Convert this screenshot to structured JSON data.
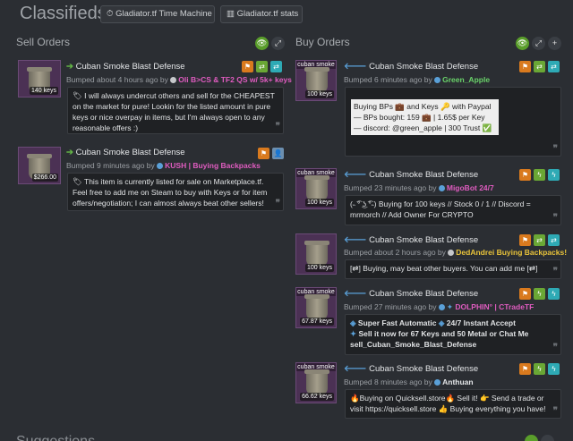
{
  "header": {
    "title": "Classifieds",
    "btn_time_machine": "Gladiator.tf Time Machine",
    "btn_stats": "Gladiator.tf stats"
  },
  "sell": {
    "title": "Sell Orders",
    "items": [
      {
        "name": "Cuban Smoke Blast Defense",
        "price": "140 keys",
        "bumped": "Bumped about 4 hours ago by",
        "user": "Oli B>CS & TF2 QS w/ 5k+ keys",
        "comment": "I will always undercut others and sell for the CHEAPEST on the market for pure! Lookin for the listed amount in pure keys or nice overpay in items, but I'm always open to any reasonable offers :)"
      },
      {
        "name": "Cuban Smoke Blast Defense",
        "price": "$266.00",
        "bumped": "Bumped 9 minutes ago by",
        "user": "KUSH | Buying Backpacks",
        "comment": "This item is currently listed for sale on Marketplace.tf. Feel free to add me on Steam to buy with Keys or for item offers/negotiation; I can almost always beat other sellers!"
      }
    ]
  },
  "buy": {
    "title": "Buy Orders",
    "items": [
      {
        "name": "Cuban Smoke Blast Defense",
        "price": "100 keys",
        "thumb_label": "cuban smoke",
        "bumped": "Bumped 6 minutes ago by",
        "user": "Green_Apple",
        "comment_lines": [
          "Buying BPs 💼 and Keys 🔑 with Paypal",
          "— BPs bought: 159 💼 | 1.65$ per Key",
          "— discord: @green_apple | 300 Trust ✅"
        ]
      },
      {
        "name": "Cuban Smoke Blast Defense",
        "price": "100 keys",
        "thumb_label": "cuban smoke",
        "bumped": "Bumped 23 minutes ago by",
        "user": "MigoBot 24/7",
        "comment": "(˵ ͡° ͜ʖ ͡°˵) Buying for 100 keys // Stock 0 / 1 // Discord = mrmorch // Add Owner For CRYPTO"
      },
      {
        "name": "Cuban Smoke Blast Defense",
        "price": "100 keys",
        "thumb_label": "",
        "bumped": "Bumped about 2 hours ago by",
        "user": "DedAndrei Buying Backpacks!",
        "comment": "[⇄] Buying, may beat other buyers. You can add me [⇄]"
      },
      {
        "name": "Cuban Smoke Blast Defense",
        "price": "67.87 keys",
        "thumb_label": "cuban smoke",
        "bumped": "Bumped 27 minutes ago by",
        "user": "DOLPHIN° | CTradeTF",
        "comment_l1": "Super Fast Automatic",
        "comment_l1b": "24/7 Instant Accept",
        "comment_l2": "Sell it now for 67 Keys and 50 Metal or Chat Me",
        "comment_l3": "sell_Cuban_Smoke_Blast_Defense"
      },
      {
        "name": "Cuban Smoke Blast Defense",
        "price": "66.62 keys",
        "thumb_label": "cuban smoke",
        "bumped": "Bumped 8 minutes ago by",
        "user": "Anthuan",
        "comment": "🔥Buying on Quicksell.store🔥 Sell it! 👉 Send a trade or visit https://quicksell.store 👍 Buying everything you have!"
      }
    ]
  },
  "footer": {
    "title": "Suggestions"
  },
  "colors": {
    "background": "#2b2e33",
    "accent_green": "#5a9e2b",
    "user_pink": "#e05cc0",
    "user_yellow": "#e8c33a",
    "user_green": "#6ad36a"
  }
}
